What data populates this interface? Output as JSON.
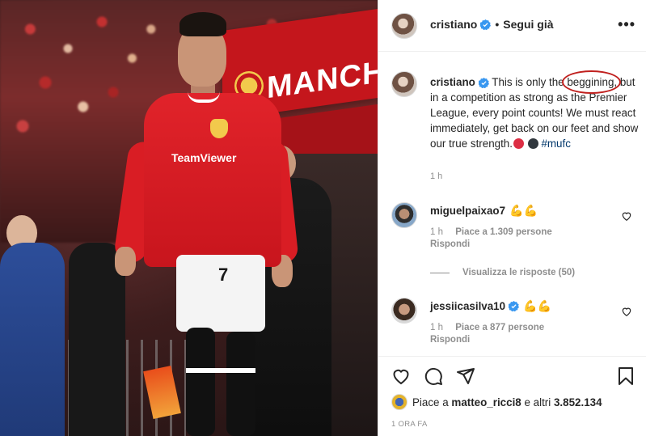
{
  "post": {
    "username": "cristiano",
    "header_dot": "•",
    "follow_status": "Segui già",
    "more_icon": "more-horizontal-icon",
    "photo_text": {
      "banner": "MANCH",
      "sponsor": "TeamViewer",
      "shirt_number": "7",
      "sign_number": "7"
    }
  },
  "caption": {
    "username": "cristiano",
    "text_before": " This is only the ",
    "circled_word": "beggining,",
    "text_after": " but in a competition as strong as the Premier League, every point counts! We must react immediately, get back on our feet and show our true strength.",
    "hashtag": "#mufc",
    "time": "1 h"
  },
  "comments": [
    {
      "username": "miguelpaixao7",
      "emoji": "💪🏽",
      "time": "1 h",
      "likes": "Piace a 1.309 persone",
      "reply": "Rispondi"
    },
    {
      "username": "jessiicasilva10",
      "emoji": "💪🏽",
      "time": "1 h",
      "likes": "Piace a 877 persone",
      "reply": "Rispondi"
    }
  ],
  "view_replies": "Visualizza le risposte (50)",
  "footer": {
    "likes_prefix": "Piace a ",
    "likes_user": "matteo_ricci8",
    "likes_suffix": " e altri ",
    "likes_count": "3.852.134",
    "timestamp": "1 ORA FA"
  },
  "colors": {
    "verified": "#3897f0",
    "circle_annotation": "#c0201e",
    "hashtag": "#00376b",
    "secondary_text": "#8e8e8e"
  }
}
